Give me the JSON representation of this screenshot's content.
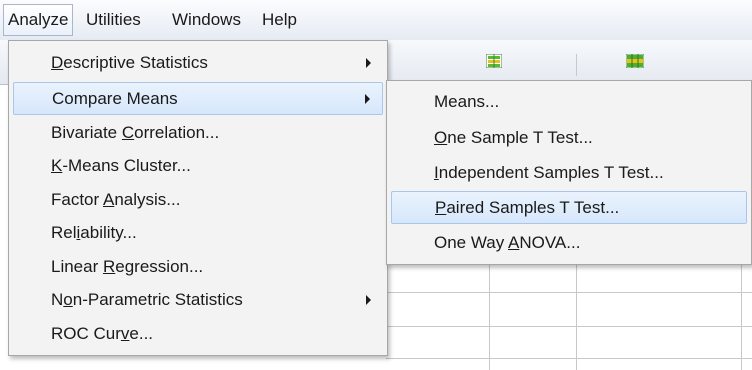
{
  "menubar": {
    "items": [
      {
        "label": "Analyze",
        "active": true
      },
      {
        "label": "Utilities"
      },
      {
        "label": "Windows"
      },
      {
        "label": "Help"
      }
    ]
  },
  "analyze_menu": {
    "items": [
      {
        "label": "Descriptive Statistics",
        "mnemonic_index": 0,
        "has_submenu": true
      },
      {
        "label": "Compare Means",
        "has_submenu": true,
        "highlighted": true
      },
      {
        "label": "Bivariate Correlation...",
        "mnemonic_index": 10
      },
      {
        "label": "K-Means Cluster...",
        "mnemonic_index": 0
      },
      {
        "label": "Factor Analysis...",
        "mnemonic_index": 7
      },
      {
        "label": "Reliability...",
        "mnemonic_index": 3
      },
      {
        "label": "Linear Regression...",
        "mnemonic_index": 7
      },
      {
        "label": "Non-Parametric Statistics",
        "mnemonic_index": 1,
        "has_submenu": true
      },
      {
        "label": "ROC Curve...",
        "mnemonic_index": 7
      }
    ]
  },
  "compare_means_submenu": {
    "items": [
      {
        "label": "Means..."
      },
      {
        "label": "One Sample T Test...",
        "mnemonic_index": 0
      },
      {
        "label": "Independent Samples T Test...",
        "mnemonic_index": 0
      },
      {
        "label": "Paired Samples T Test...",
        "mnemonic_index": 0,
        "highlighted": true
      },
      {
        "label": "One Way ANOVA...",
        "mnemonic_index": 8
      }
    ]
  },
  "toolbar": {
    "icons": [
      "insert-cases-icon",
      "insert-variable-icon"
    ]
  },
  "colors": {
    "highlight_bg": "#d6e7fb",
    "highlight_border": "#a9c7ea",
    "menu_bg": "#f3f3f3",
    "icon_green": "#4caf32",
    "icon_yellow": "#e8c21a"
  }
}
